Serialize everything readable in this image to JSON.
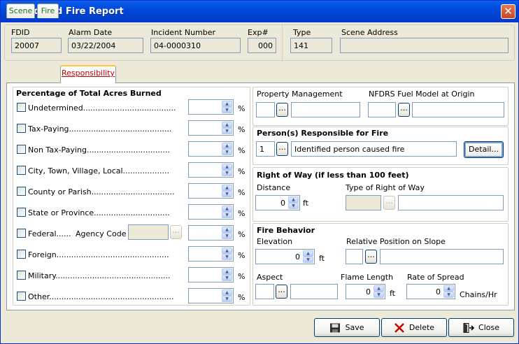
{
  "window": {
    "title": "Wildland Fire Report",
    "close_glyph": "✕"
  },
  "header": {
    "fdid": {
      "label": "FDID",
      "value": "20007"
    },
    "alarm_date": {
      "label": "Alarm Date",
      "value": "03/22/2004"
    },
    "incident_number": {
      "label": "Incident Number",
      "value": "04-0000310"
    },
    "exp": {
      "label": "Exp#",
      "value": "000"
    },
    "type": {
      "label": "Type",
      "value": "141"
    },
    "scene_address": {
      "label": "Scene Address",
      "value": ""
    }
  },
  "tabs": [
    {
      "label": "Scene",
      "active": false
    },
    {
      "label": "Fire",
      "active": false
    },
    {
      "label": "Responsibility",
      "active": true
    }
  ],
  "acres": {
    "title": "Percentage of Total Acres Burned",
    "pct_symbol": "%",
    "items": [
      {
        "label": "Undetermined......................................",
        "value": ""
      },
      {
        "label": "Tax-Paying..........................................",
        "value": ""
      },
      {
        "label": "Non Tax-Paying..................................",
        "value": ""
      },
      {
        "label": "City, Town, Village, Local...................",
        "value": ""
      },
      {
        "label": "County or Parish..................................",
        "value": ""
      },
      {
        "label": "State or Province...............................",
        "value": ""
      },
      {
        "label": "Federal......",
        "value": ""
      },
      {
        "label": "Foreign..............................................",
        "value": ""
      },
      {
        "label": "Military...............................................",
        "value": ""
      },
      {
        "label": "Other...................................................",
        "value": ""
      }
    ],
    "agency_code": {
      "label": "Agency Code",
      "value": ""
    }
  },
  "property": {
    "management_label": "Property Management",
    "management_code": "",
    "management_desc": "",
    "nfdrs_label": "NFDRS Fuel Model at Origin",
    "nfdrs_code": "",
    "nfdrs_desc": ""
  },
  "responsible": {
    "title": "Person(s) Responsible for Fire",
    "code": "1",
    "description": "Identified person caused fire",
    "detail_label": "Detail..."
  },
  "right_of_way": {
    "title": "Right of Way (if less than 100 feet)",
    "distance_label": "Distance",
    "distance_value": "0",
    "distance_unit": "ft",
    "type_label": "Type of Right of Way",
    "type_code": "",
    "type_desc": ""
  },
  "fire_behavior": {
    "title": "Fire Behavior",
    "elevation_label": "Elevation",
    "elevation_value": "0",
    "elevation_unit": "ft",
    "slope_label": "Relative Position on Slope",
    "slope_code": "",
    "slope_desc": "",
    "aspect_label": "Aspect",
    "aspect_code": "",
    "aspect_desc": "",
    "flame_label": "Flame Length",
    "flame_value": "0",
    "flame_unit": "ft",
    "spread_label": "Rate of Spread",
    "spread_value": "0",
    "spread_unit": "Chains/Hr"
  },
  "ellipsis": "...",
  "spin_up": "▲",
  "spin_down": "▼",
  "buttons": {
    "save": "Save",
    "delete": "Delete",
    "close": "Close"
  },
  "colors": {
    "title_bar": "#0A5FE8",
    "window_bg": "#ECE9D8",
    "tab_active_accent": "#FFC83C",
    "delete_x": "#CC0000"
  }
}
